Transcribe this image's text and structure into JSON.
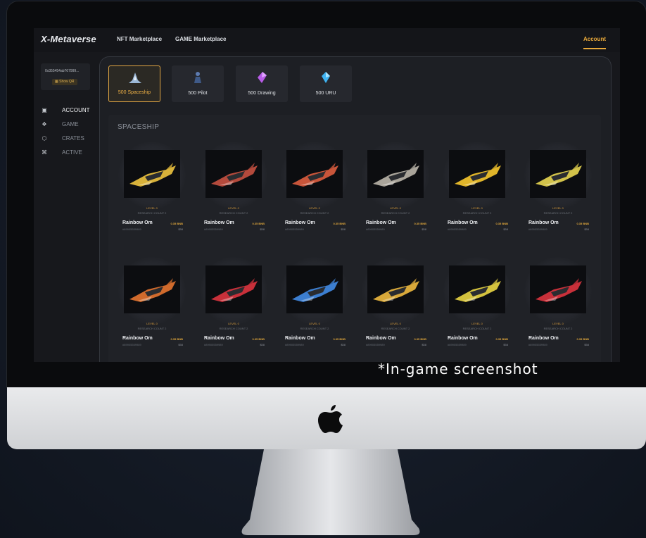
{
  "nav": {
    "logo": "X-Metaverse",
    "links": [
      "NFT Marketplace",
      "GAME Marketplace"
    ],
    "account": "Account"
  },
  "wallet": {
    "address": "0x355454ab767999...",
    "show_qr": "Show QR"
  },
  "sidebar": {
    "items": [
      {
        "label": "ACCOUNT",
        "icon": "wallet-icon"
      },
      {
        "label": "GAME",
        "icon": "game-icon"
      },
      {
        "label": "CRATES",
        "icon": "crate-icon"
      },
      {
        "label": "ACTIVE",
        "icon": "active-icon"
      }
    ]
  },
  "tabs": [
    {
      "label": "500 Spaceship",
      "icon": "spaceship-icon",
      "color": "#9ab7d6"
    },
    {
      "label": "500 Pilot",
      "icon": "pilot-icon",
      "color": "#5d7bb0"
    },
    {
      "label": "500 Drawing",
      "icon": "drawing-gem-icon",
      "color": "#b85ce8"
    },
    {
      "label": "500 URU",
      "icon": "uru-crystal-icon",
      "color": "#3fb3f2"
    }
  ],
  "section_title": "SPACESHIP",
  "cards": [
    {
      "level": "LEVEL 0",
      "research": "RESEARCH COUNT 2",
      "name": "Rainbow Om",
      "price": "0.35 BNB",
      "id": "#89905559989",
      "usd": "$58",
      "ship_color": "#d8b23a"
    },
    {
      "level": "LEVEL 0",
      "research": "RESEARCH COUNT 2",
      "name": "Rainbow Om",
      "price": "0.35 BNB",
      "id": "#89905559989",
      "usd": "$58",
      "ship_color": "#b44a3c"
    },
    {
      "level": "LEVEL 0",
      "research": "RESEARCH COUNT 2",
      "name": "Rainbow Om",
      "price": "0.35 BNB",
      "id": "#89905559989",
      "usd": "$58",
      "ship_color": "#c8553a"
    },
    {
      "level": "LEVEL 0",
      "research": "RESEARCH COUNT 2",
      "name": "Rainbow Om",
      "price": "0.35 BNB",
      "id": "#89905559989",
      "usd": "$58",
      "ship_color": "#a9a49a"
    },
    {
      "level": "LEVEL 0",
      "research": "RESEARCH COUNT 2",
      "name": "Rainbow Om",
      "price": "0.35 BNB",
      "id": "#89905559989",
      "usd": "$58",
      "ship_color": "#e0b52a"
    },
    {
      "level": "LEVEL 0",
      "research": "RESEARCH COUNT 2",
      "name": "Rainbow Om",
      "price": "0.35 BNB",
      "id": "#89905559989",
      "usd": "$58",
      "ship_color": "#d2c24a"
    },
    {
      "level": "LEVEL 0",
      "research": "RESEARCH COUNT 2",
      "name": "Rainbow Om",
      "price": "0.35 BNB",
      "id": "#89905559989",
      "usd": "$58",
      "ship_color": "#d06a2c"
    },
    {
      "level": "LEVEL 0",
      "research": "RESEARCH COUNT 2",
      "name": "Rainbow Om",
      "price": "0.35 BNB",
      "id": "#89905559989",
      "usd": "$58",
      "ship_color": "#c8303a"
    },
    {
      "level": "LEVEL 0",
      "research": "RESEARCH COUNT 2",
      "name": "Rainbow Om",
      "price": "0.35 BNB",
      "id": "#89905559989",
      "usd": "$58",
      "ship_color": "#3c7ed0"
    },
    {
      "level": "LEVEL 0",
      "research": "RESEARCH COUNT 2",
      "name": "Rainbow Om",
      "price": "0.35 BNB",
      "id": "#89905559989",
      "usd": "$58",
      "ship_color": "#d8a83a"
    },
    {
      "level": "LEVEL 0",
      "research": "RESEARCH COUNT 2",
      "name": "Rainbow Om",
      "price": "0.35 BNB",
      "id": "#89905559989",
      "usd": "$58",
      "ship_color": "#d4c23e"
    },
    {
      "level": "LEVEL 0",
      "research": "RESEARCH COUNT 2",
      "name": "Rainbow Om",
      "price": "0.35 BNB",
      "id": "#89905559989",
      "usd": "$58",
      "ship_color": "#c8303a"
    }
  ],
  "caption": "*In-game screenshot",
  "colors": {
    "accent": "#e9a93a",
    "background": "#17181c"
  }
}
